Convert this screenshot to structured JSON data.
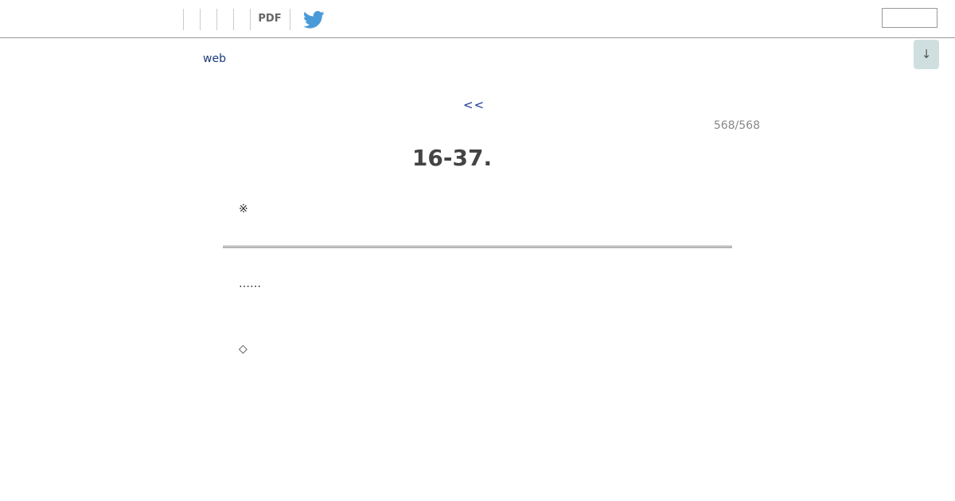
{
  "header": {
    "pdf_label": "PDF",
    "twitter_icon": "twitter-bird-icon",
    "twitter_color": "#4a9ad8",
    "search": {
      "value": "",
      "placeholder": ""
    }
  },
  "scroll_button": {
    "label": "↓",
    "color": "#cfdfdf"
  },
  "links": {
    "web": "web",
    "prev": "<<"
  },
  "pagination": {
    "counter": "568/568"
  },
  "content": {
    "title": "16-37.",
    "mark": "※",
    "ellipsis": "……",
    "diamond": "◇"
  }
}
